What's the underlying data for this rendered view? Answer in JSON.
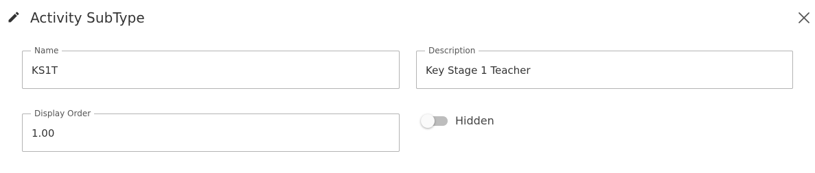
{
  "dialog": {
    "title": "Activity SubType",
    "icons": {
      "title_icon": "pencil-icon",
      "close_icon": "close-icon"
    }
  },
  "form": {
    "name": {
      "label": "Name",
      "value": "KS1T"
    },
    "description": {
      "label": "Description",
      "value": "Key Stage 1 Teacher"
    },
    "display_order": {
      "label": "Display Order",
      "value": "1.00"
    },
    "hidden": {
      "label": "Hidden",
      "checked": false
    }
  },
  "colors": {
    "border": "#b3b3b3",
    "text": "#333333",
    "toggle_track": "#bdbdbd"
  }
}
